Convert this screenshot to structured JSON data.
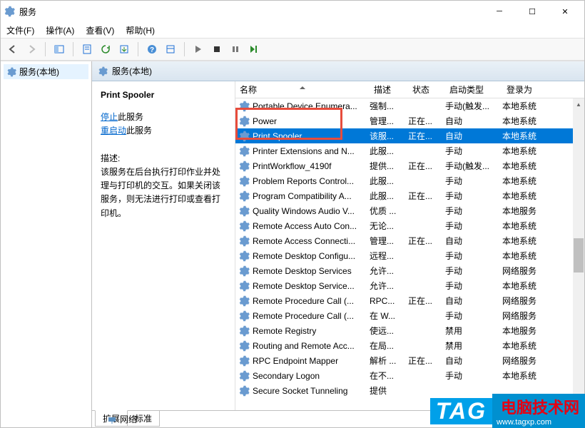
{
  "window": {
    "title": "服务"
  },
  "menu": {
    "file": "文件(F)",
    "action": "操作(A)",
    "view": "查看(V)",
    "help": "帮助(H)"
  },
  "nav": {
    "root": "服务(本地)"
  },
  "main_header": "服务(本地)",
  "detail": {
    "name": "Print Spooler",
    "stop": "停止",
    "stop_suffix": "此服务",
    "restart": "重启动",
    "restart_suffix": "此服务",
    "desc_label": "描述:",
    "desc": "该服务在后台执行打印作业并处理与打印机的交互。如果关闭该服务，则无法进行打印或查看打印机。"
  },
  "cols": {
    "name": "名称",
    "desc": "描述",
    "status": "状态",
    "start": "启动类型",
    "logon": "登录为"
  },
  "rows": [
    {
      "name": "Portable Device Enumera...",
      "desc": "强制...",
      "status": "",
      "start": "手动(触发...",
      "logon": "本地系统"
    },
    {
      "name": "Power",
      "desc": "管理...",
      "status": "正在...",
      "start": "自动",
      "logon": "本地系统"
    },
    {
      "name": "Print Spooler",
      "desc": "该服...",
      "status": "正在...",
      "start": "自动",
      "logon": "本地系统",
      "selected": true
    },
    {
      "name": "Printer Extensions and N...",
      "desc": "此服...",
      "status": "",
      "start": "手动",
      "logon": "本地系统"
    },
    {
      "name": "PrintWorkflow_4190f",
      "desc": "提供...",
      "status": "正在...",
      "start": "手动(触发...",
      "logon": "本地系统"
    },
    {
      "name": "Problem Reports Control...",
      "desc": "此服...",
      "status": "",
      "start": "手动",
      "logon": "本地系统"
    },
    {
      "name": "Program Compatibility A...",
      "desc": "此服...",
      "status": "正在...",
      "start": "手动",
      "logon": "本地系统"
    },
    {
      "name": "Quality Windows Audio V...",
      "desc": "优质 ...",
      "status": "",
      "start": "手动",
      "logon": "本地服务"
    },
    {
      "name": "Remote Access Auto Con...",
      "desc": "无论...",
      "status": "",
      "start": "手动",
      "logon": "本地系统"
    },
    {
      "name": "Remote Access Connecti...",
      "desc": "管理...",
      "status": "正在...",
      "start": "自动",
      "logon": "本地系统"
    },
    {
      "name": "Remote Desktop Configu...",
      "desc": "远程...",
      "status": "",
      "start": "手动",
      "logon": "本地系统"
    },
    {
      "name": "Remote Desktop Services",
      "desc": "允许...",
      "status": "",
      "start": "手动",
      "logon": "网络服务"
    },
    {
      "name": "Remote Desktop Service...",
      "desc": "允许...",
      "status": "",
      "start": "手动",
      "logon": "本地系统"
    },
    {
      "name": "Remote Procedure Call (...",
      "desc": "RPC...",
      "status": "正在...",
      "start": "自动",
      "logon": "网络服务"
    },
    {
      "name": "Remote Procedure Call (...",
      "desc": "在 W...",
      "status": "",
      "start": "手动",
      "logon": "网络服务"
    },
    {
      "name": "Remote Registry",
      "desc": "使远...",
      "status": "",
      "start": "禁用",
      "logon": "本地服务"
    },
    {
      "name": "Routing and Remote Acc...",
      "desc": "在局...",
      "status": "",
      "start": "禁用",
      "logon": "本地系统"
    },
    {
      "name": "RPC Endpoint Mapper",
      "desc": "解析 ...",
      "status": "正在...",
      "start": "自动",
      "logon": "网络服务"
    },
    {
      "name": "Secondary Logon",
      "desc": "在不...",
      "status": "",
      "start": "手动",
      "logon": "本地系统"
    },
    {
      "name": "Secure Socket Tunneling",
      "desc": "提供",
      "status": "",
      "start": "",
      "logon": ""
    }
  ],
  "tabs": {
    "ext": "扩展",
    "std": "标准"
  },
  "below": "网络",
  "watermark": {
    "tag": "TAG",
    "text": "电脑技术网",
    "url": "www.tagxp.com"
  }
}
